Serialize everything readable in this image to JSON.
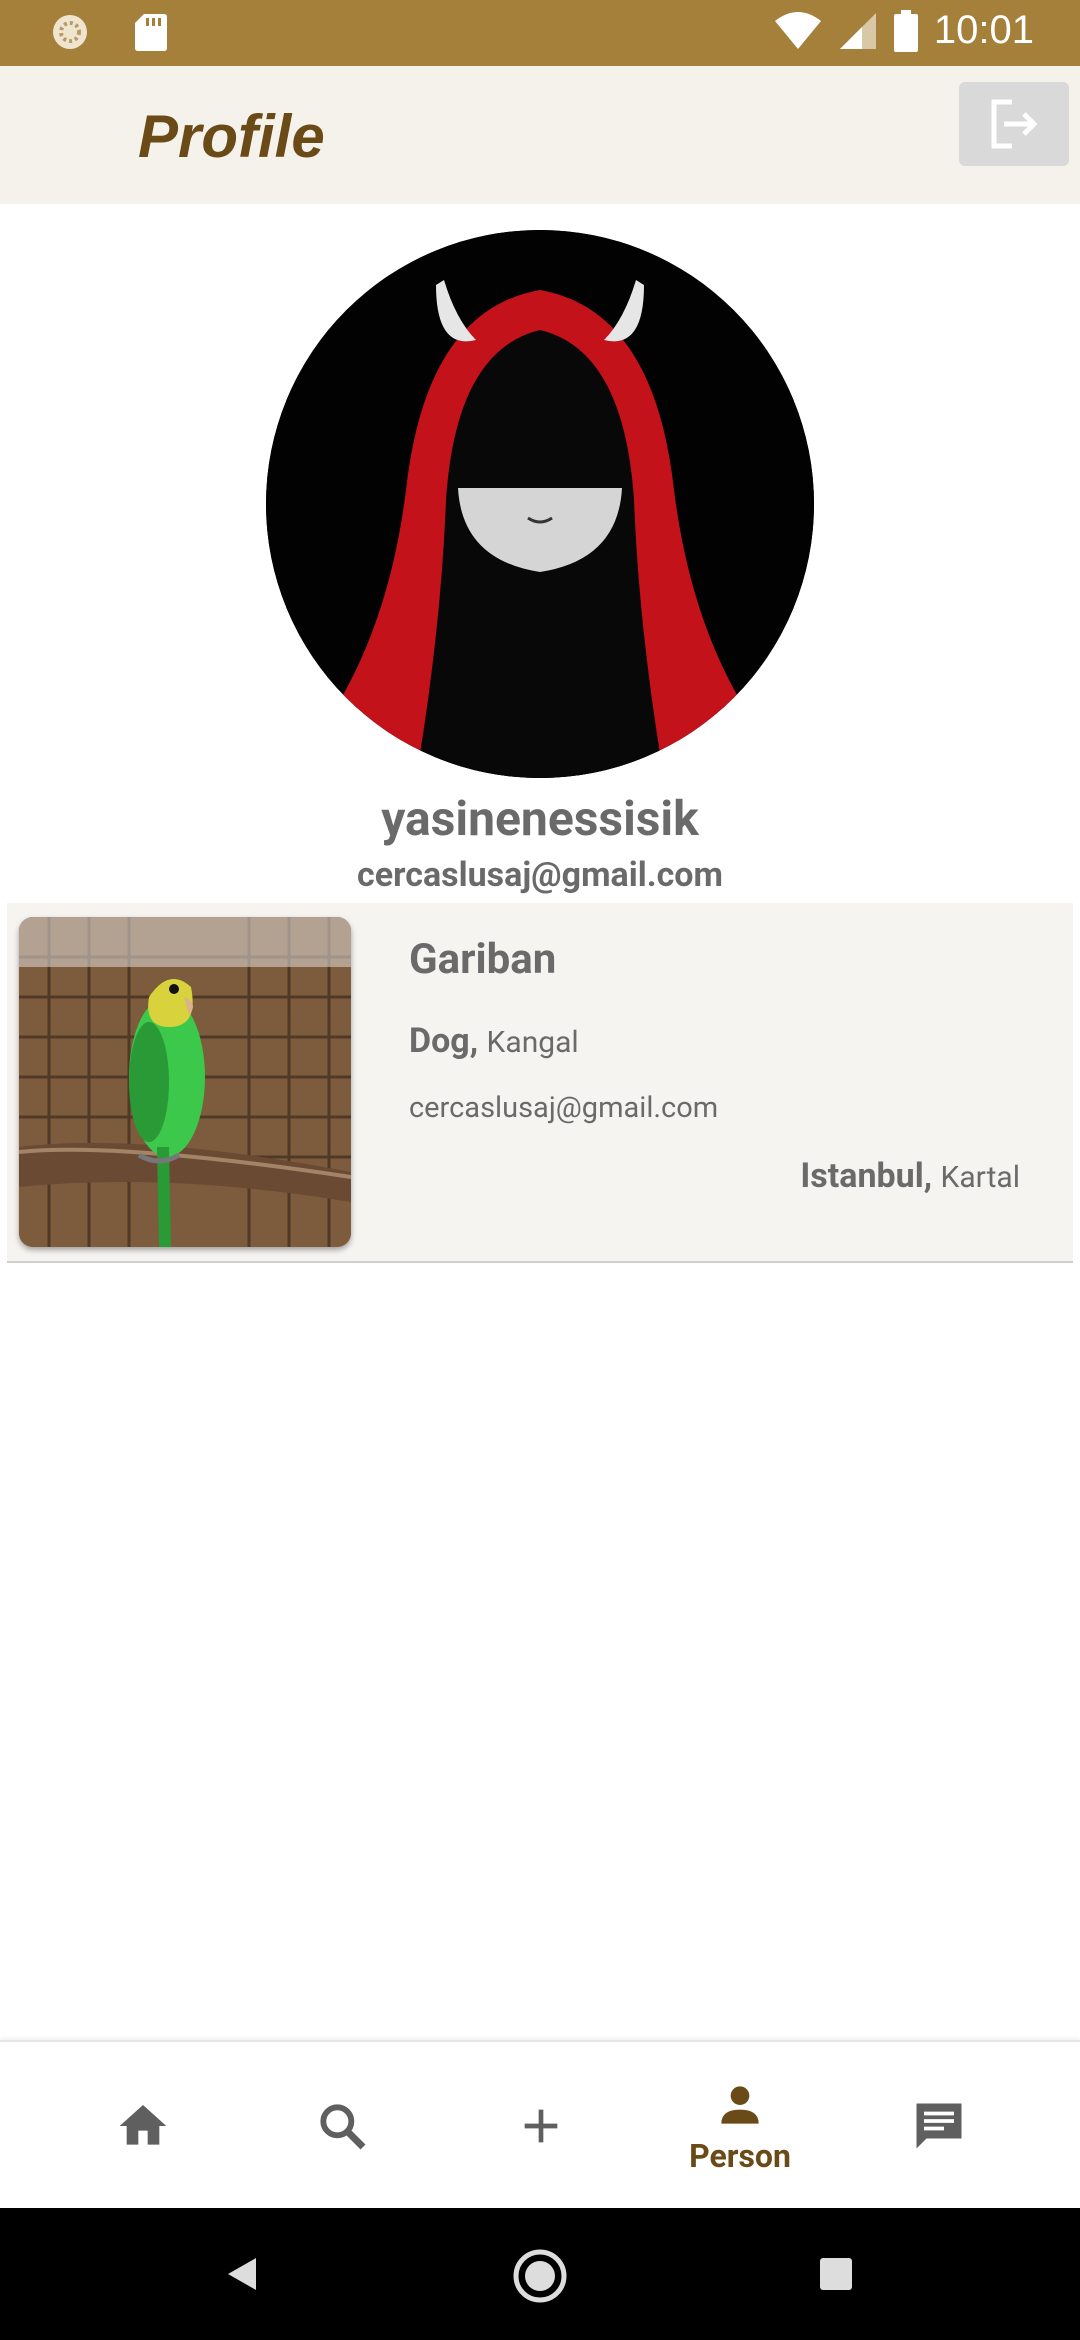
{
  "status_bar": {
    "time": "10:01",
    "icons": [
      "loading-icon",
      "sd-card-icon",
      "wifi-icon",
      "cell-signal-icon",
      "battery-icon"
    ]
  },
  "app_bar": {
    "title": "Profile",
    "logout_icon": "logout-icon"
  },
  "profile": {
    "username": "yasinenessisik",
    "email": "cercaslusaj@gmail.com"
  },
  "pet_card": {
    "name": "Gariban",
    "type": "Dog",
    "breed": "Kangal",
    "email": "cercaslusaj@gmail.com",
    "city": "Istanbul",
    "district": "Kartal"
  },
  "bottom_nav": {
    "items": [
      {
        "icon": "home-icon",
        "label": ""
      },
      {
        "icon": "search-icon",
        "label": ""
      },
      {
        "icon": "add-icon",
        "label": ""
      },
      {
        "icon": "person-icon",
        "label": "Person"
      },
      {
        "icon": "message-icon",
        "label": ""
      }
    ],
    "active_color": "#6a4a16",
    "inactive_color": "#5f5f5f"
  },
  "colors": {
    "status_bar": "#a5803a",
    "app_bar": "#f5f1eb",
    "title": "#6a4a16",
    "text_gray": "#6a6a6a"
  }
}
